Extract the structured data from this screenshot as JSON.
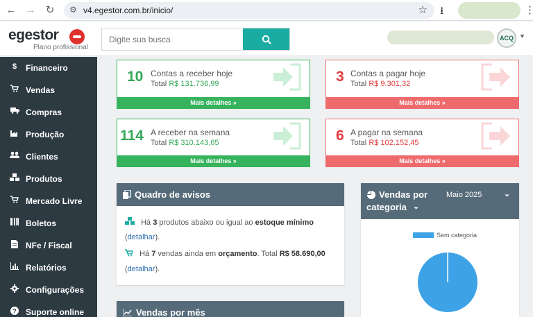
{
  "browser": {
    "url": "v4.egestor.com.br/inicio/"
  },
  "header": {
    "logo_text": "egestor",
    "logo_sub": "Plano profissional",
    "search_placeholder": "Digite sua busca",
    "avatar_initials": "ACQ"
  },
  "sidebar": {
    "items": [
      {
        "label": "Financeiro",
        "icon": "dollar-icon",
        "glyph": "$"
      },
      {
        "label": "Vendas",
        "icon": "cart-icon",
        "glyph": "🛒"
      },
      {
        "label": "Compras",
        "icon": "truck-icon",
        "glyph": "🚚"
      },
      {
        "label": "Produção",
        "icon": "factory-icon",
        "glyph": "▙"
      },
      {
        "label": "Clientes",
        "icon": "users-icon",
        "glyph": "👥"
      },
      {
        "label": "Produtos",
        "icon": "cubes-icon",
        "glyph": "❖"
      },
      {
        "label": "Mercado Livre",
        "icon": "cart-icon",
        "glyph": "🛒"
      },
      {
        "label": "Boletos",
        "icon": "barcode-icon",
        "glyph": "▥"
      },
      {
        "label": "NFe / Fiscal",
        "icon": "document-icon",
        "glyph": "▤"
      },
      {
        "label": "Relatórios",
        "icon": "bar-chart-icon",
        "glyph": "▇"
      },
      {
        "label": "Configurações",
        "icon": "gear-icon",
        "glyph": "⚙"
      },
      {
        "label": "Suporte online",
        "icon": "question-icon",
        "glyph": "?"
      }
    ]
  },
  "cards": [
    {
      "number": "10",
      "title": "Contas a receber hoje",
      "total_label": "Total",
      "amount": "R$ 131.736,99",
      "footer": "Mais detalhes »",
      "color": "#35b45b"
    },
    {
      "number": "3",
      "title": "Contas a pagar hoje",
      "total_label": "Total",
      "amount": "R$ 9.301,32",
      "footer": "Mais detalhes »",
      "color": "#ee6b6d"
    },
    {
      "number": "114",
      "title": "A receber na semana",
      "total_label": "Total",
      "amount": "R$ 310.143,65",
      "footer": "Mais detalhes »",
      "color": "#35b45b"
    },
    {
      "number": "6",
      "title": "A pagar na semana",
      "total_label": "Total",
      "amount": "R$ 102.152,45",
      "footer": "Mais detalhes »",
      "color": "#ee6b6d"
    }
  ],
  "quadro": {
    "title": "Quadro de avisos",
    "row1_prefix": "Há",
    "row1_count": "3",
    "row1_mid": "produtos abaixo ou igual ao",
    "row1_bold": "estoque mínimo",
    "row2_prefix": "Há",
    "row2_count": "7",
    "row2_mid": "vendas ainda em",
    "row2_bold": "orçamento",
    "row2_total_label": ". Total",
    "row2_total": "R$ 58.690,00",
    "link_open": "(",
    "link_text": "detalhar",
    "link_close": ")."
  },
  "vendas_categoria": {
    "title_line1": "Vendas por",
    "title_line2": "categoria",
    "period": "Maio 2025",
    "legend": "Sem categoria",
    "chart_data": {
      "type": "pie",
      "categories": [
        "Sem categoria"
      ],
      "values": [
        100
      ],
      "colors": [
        "#3da2e6"
      ]
    }
  },
  "vendas_mes": {
    "title": "Vendas por mês"
  },
  "colors": {
    "sidebar_bg": "#2d3a42",
    "accent_teal": "#1aaca2",
    "panel_head": "#566b79",
    "green": "#35b45b",
    "red": "#ee6b6d"
  }
}
